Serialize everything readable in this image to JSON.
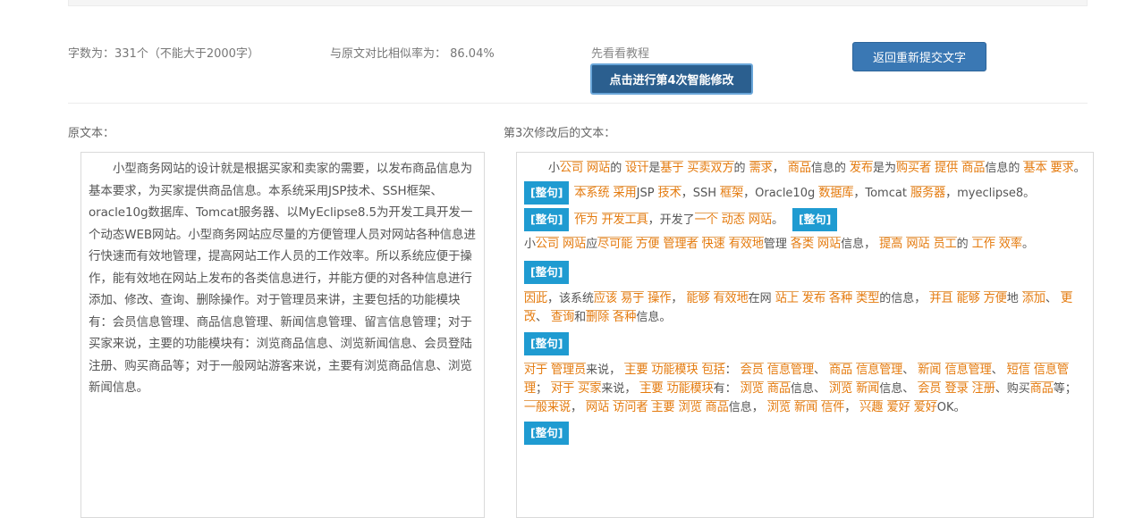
{
  "stats": {
    "word_count": "字数为：331个（不能大于2000字）",
    "similarity": "与原文对比相似率为： 86.04%"
  },
  "tutorial_hint": "先看看教程",
  "buttons": {
    "smart_modify": "点击进行第4次智能修改",
    "resubmit": "返回重新提交文字"
  },
  "labels": {
    "original": "原文本：",
    "modified": "第3次修改后的文本："
  },
  "original_text": "小型商务网站的设计就是根据买家和卖家的需要，以发布商品信息为基本要求，为买家提供商品信息。本系统采用JSP技术、SSH框架、oracle10g数据库、Tomcat服务器、以MyEclipse8.5为开发工具开发一个动态WEB网站。小型商务网站应尽量的方便管理人员对网站各种信息进行快速而有效地管理，提高网站工作人员的工作效率。所以系统应便于操作，能有效地在网站上发布的各类信息进行，并能方便的对各种信息进行添加、修改、查询、删除操作。对于管理员来讲，主要包括的功能模块有：会员信息管理、商品信息管理、新闻信息管理、留言信息管理；对于买家来说，主要的功能模块有：浏览商品信息、浏览新闻信息、会员登陆注册、购买商品等；对于一般网站游客来说，主要有浏览商品信息、浏览新闻信息。",
  "modified": {
    "tag_label": "[整句]",
    "s1": [
      [
        "小",
        0
      ],
      [
        "公司",
        1
      ],
      [
        " ",
        0
      ],
      [
        "网站",
        1
      ],
      [
        "的 ",
        0
      ],
      [
        "设计",
        1
      ],
      [
        "是",
        0
      ],
      [
        "基于",
        1
      ],
      [
        " ",
        0
      ],
      [
        "买卖双方",
        1
      ],
      [
        "的 ",
        0
      ],
      [
        "需求",
        1
      ],
      [
        "， ",
        0
      ],
      [
        "商品",
        1
      ],
      [
        "信息的 ",
        0
      ],
      [
        "发布",
        1
      ],
      [
        "是为",
        0
      ],
      [
        "购买者",
        1
      ],
      [
        " ",
        0
      ],
      [
        "提供",
        1
      ],
      [
        " ",
        0
      ],
      [
        "商品",
        1
      ],
      [
        "信息的 ",
        0
      ],
      [
        "基本",
        1
      ],
      [
        " ",
        0
      ],
      [
        "要求",
        1
      ],
      [
        "。",
        0
      ]
    ],
    "s2": [
      [
        "本系统",
        1
      ],
      [
        " ",
        0
      ],
      [
        "采用",
        1
      ],
      [
        "JSP ",
        0
      ],
      [
        "技术",
        1
      ],
      [
        "，SSH ",
        0
      ],
      [
        "框架",
        1
      ],
      [
        "，Oracle10g ",
        0
      ],
      [
        "数据库",
        1
      ],
      [
        "，Tomcat ",
        0
      ],
      [
        "服务器",
        1
      ],
      [
        "，myeclipse8。",
        0
      ]
    ],
    "s3": [
      [
        "作为",
        1
      ],
      [
        " ",
        0
      ],
      [
        "开发工具",
        1
      ],
      [
        "，开发了",
        0
      ],
      [
        "一个",
        1
      ],
      [
        " ",
        0
      ],
      [
        "动态",
        1
      ],
      [
        " ",
        0
      ],
      [
        "网站",
        1
      ],
      [
        "。",
        0
      ]
    ],
    "s4": [
      [
        "小",
        0
      ],
      [
        "公司",
        1
      ],
      [
        " ",
        0
      ],
      [
        "网站",
        1
      ],
      [
        "应",
        0
      ],
      [
        "尽可能",
        1
      ],
      [
        " ",
        0
      ],
      [
        "方便",
        1
      ],
      [
        " ",
        0
      ],
      [
        "管理者",
        1
      ],
      [
        " ",
        0
      ],
      [
        "快速",
        1
      ],
      [
        " ",
        0
      ],
      [
        "有效地",
        1
      ],
      [
        "管理 ",
        0
      ],
      [
        "各类",
        1
      ],
      [
        " ",
        0
      ],
      [
        "网站",
        1
      ],
      [
        "信息， ",
        0
      ],
      [
        "提高",
        1
      ],
      [
        " ",
        0
      ],
      [
        "网站",
        1
      ],
      [
        " ",
        0
      ],
      [
        "员工",
        1
      ],
      [
        "的 ",
        0
      ],
      [
        "工作",
        1
      ],
      [
        " ",
        0
      ],
      [
        "效率",
        1
      ],
      [
        "。",
        0
      ]
    ],
    "s5": [
      [
        "因此",
        1
      ],
      [
        "，该系统",
        0
      ],
      [
        "应该",
        1
      ],
      [
        " ",
        0
      ],
      [
        "易于",
        1
      ],
      [
        " ",
        0
      ],
      [
        "操作",
        1
      ],
      [
        "， ",
        0
      ],
      [
        "能够",
        1
      ],
      [
        " ",
        0
      ],
      [
        "有效地",
        1
      ],
      [
        "在网 ",
        0
      ],
      [
        "站上",
        1
      ],
      [
        " ",
        0
      ],
      [
        "发布",
        1
      ],
      [
        " ",
        0
      ],
      [
        "各种",
        1
      ],
      [
        " ",
        0
      ],
      [
        "类型",
        1
      ],
      [
        "的信息， ",
        0
      ],
      [
        "并且",
        1
      ],
      [
        " ",
        0
      ],
      [
        "能够",
        1
      ],
      [
        " ",
        0
      ],
      [
        "方便",
        1
      ],
      [
        "地 ",
        0
      ],
      [
        "添加",
        1
      ],
      [
        "、 ",
        0
      ],
      [
        "更改",
        1
      ],
      [
        "、 ",
        0
      ],
      [
        "查询",
        1
      ],
      [
        "和",
        0
      ],
      [
        "删除",
        1
      ],
      [
        " ",
        0
      ],
      [
        "各种",
        1
      ],
      [
        "信息。",
        0
      ]
    ],
    "s6": [
      [
        "对于",
        1
      ],
      [
        " ",
        0
      ],
      [
        "管理员",
        1
      ],
      [
        "来说， ",
        0
      ],
      [
        "主要",
        1
      ],
      [
        " ",
        0
      ],
      [
        "功能模块",
        1
      ],
      [
        " ",
        0
      ],
      [
        "包括",
        1
      ],
      [
        "： ",
        0
      ],
      [
        "会员",
        1
      ],
      [
        " ",
        0
      ],
      [
        "信息管理",
        1
      ],
      [
        "、 ",
        0
      ],
      [
        "商品",
        1
      ],
      [
        " ",
        0
      ],
      [
        "信息管理",
        1
      ],
      [
        "、 ",
        0
      ],
      [
        "新闻",
        1
      ],
      [
        " ",
        0
      ],
      [
        "信息管理",
        1
      ],
      [
        "、 ",
        0
      ],
      [
        "短信",
        1
      ],
      [
        " ",
        0
      ],
      [
        "信息管理",
        1
      ],
      [
        "； ",
        0
      ],
      [
        "对于",
        1
      ],
      [
        " ",
        0
      ],
      [
        "买家",
        1
      ],
      [
        "来说， ",
        0
      ],
      [
        "主要",
        1
      ],
      [
        " ",
        0
      ],
      [
        "功能模块",
        1
      ],
      [
        "有： ",
        0
      ],
      [
        "浏览",
        1
      ],
      [
        " ",
        0
      ],
      [
        "商品",
        1
      ],
      [
        "信息、 ",
        0
      ],
      [
        "浏览",
        1
      ],
      [
        " ",
        0
      ],
      [
        "新闻",
        1
      ],
      [
        "信息、 ",
        0
      ],
      [
        "会员",
        1
      ],
      [
        " ",
        0
      ],
      [
        "登录",
        1
      ],
      [
        " ",
        0
      ],
      [
        "注册",
        1
      ],
      [
        "、购买",
        0
      ],
      [
        "商品",
        1
      ],
      [
        "等； ",
        0
      ],
      [
        "一般来说",
        1
      ],
      [
        "， ",
        0
      ],
      [
        "网站",
        1
      ],
      [
        " ",
        0
      ],
      [
        "访问者",
        1
      ],
      [
        " ",
        0
      ],
      [
        "主要",
        1
      ],
      [
        " ",
        0
      ],
      [
        "浏览",
        1
      ],
      [
        " ",
        0
      ],
      [
        "商品",
        1
      ],
      [
        "信息， ",
        0
      ],
      [
        "浏览",
        1
      ],
      [
        " ",
        0
      ],
      [
        "新闻",
        1
      ],
      [
        " ",
        0
      ],
      [
        "信件",
        1
      ],
      [
        "， ",
        0
      ],
      [
        "兴趣",
        1
      ],
      [
        " ",
        0
      ],
      [
        "爱好",
        1
      ],
      [
        " ",
        0
      ],
      [
        "爱好",
        1
      ],
      [
        "OK。",
        0
      ]
    ]
  },
  "colors": {
    "highlight": "#e4790b",
    "tag_bg": "#1f9bd1",
    "primary_button": "#2b5f8f",
    "secondary_button": "#3a78b4"
  }
}
